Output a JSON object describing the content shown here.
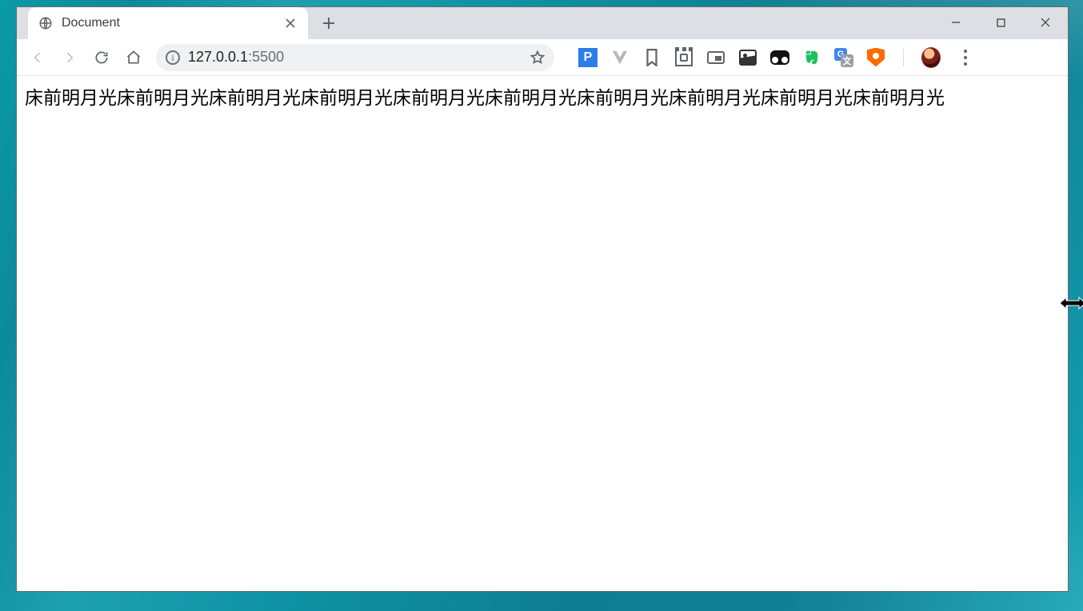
{
  "tab": {
    "title": "Document"
  },
  "address": {
    "host": "127.0.0.1",
    "port": ":5500"
  },
  "extensions": {
    "p_label": "P",
    "gt_a": "G",
    "gt_b": "文"
  },
  "page": {
    "body_text": "床前明月光床前明月光床前明月光床前明月光床前明月光床前明月光床前明月光床前明月光床前明月光床前明月光"
  }
}
